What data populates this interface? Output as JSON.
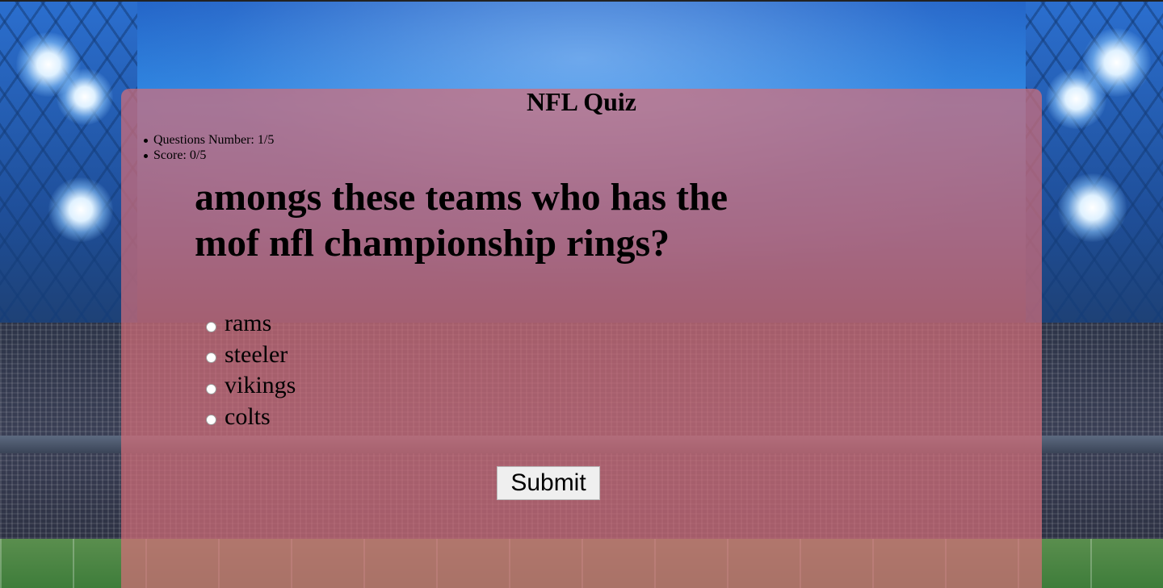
{
  "quiz": {
    "title": "NFL Quiz",
    "stats": {
      "question_number": "Questions Number: 1/5",
      "score": "Score: 0/5"
    },
    "question": "amongs these teams who has the mof nfl championship rings?",
    "options": [
      "rams",
      "steeler",
      "vikings",
      "colts"
    ],
    "submit_label": "Submit"
  },
  "colors": {
    "panel_overlay": "#d26e78",
    "sky": "#2a86e2"
  }
}
